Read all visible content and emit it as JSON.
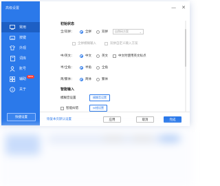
{
  "window": {
    "title": "高级设置",
    "controls": {
      "minimize": "—",
      "close": "✕"
    }
  },
  "sidebar": {
    "items": [
      {
        "label": "常用",
        "icon": "settings-panel-icon",
        "active": true
      },
      {
        "label": "按键",
        "icon": "keyboard-icon",
        "active": false
      },
      {
        "label": "外观",
        "icon": "shirt-icon",
        "active": false
      },
      {
        "label": "词库",
        "icon": "book-icon",
        "active": false
      },
      {
        "label": "账号",
        "icon": "user-icon",
        "active": false
      },
      {
        "label": "辅助",
        "icon": "grid-icon",
        "active": false,
        "badge": "NEW"
      },
      {
        "label": "关于",
        "icon": "info-icon",
        "active": false
      }
    ],
    "shortcut_button": "快捷设置"
  },
  "main": {
    "section_initial": "初始状态",
    "rows": {
      "lang": {
        "label": "全/双拼：",
        "options": [
          "全拼",
          "双拼"
        ],
        "selected": "全拼",
        "select_placeholder": "自然码方案"
      },
      "checks_disabled": [
        "全拼模糊输入",
        "双拼自定义输入方案"
      ],
      "cn_en": {
        "label": "中/英文：",
        "options": [
          "中文",
          "英文"
        ],
        "selected": "中文",
        "check": "中文时使用英文标点"
      },
      "width": {
        "label": "半/全角：",
        "options": [
          "半角",
          "全角"
        ],
        "selected": "半角"
      },
      "script": {
        "label": "简/繁体：",
        "options": [
          "简体",
          "繁体"
        ],
        "selected": "简体"
      }
    },
    "section_smart": "智能输入",
    "smart_rows": [
      {
        "label": "模糊音设置",
        "button": "模糊音设置"
      },
      {
        "check": "智能纠错",
        "button": "纠错设置"
      }
    ]
  },
  "footer": {
    "restore_link": "恢复本页默认设置",
    "apply": "应用",
    "cancel": "取消",
    "done": "完成"
  },
  "colors": {
    "accent": "#2b79ea",
    "sidebar_active": "#1d5fc4",
    "badge": "#ff3b30"
  }
}
